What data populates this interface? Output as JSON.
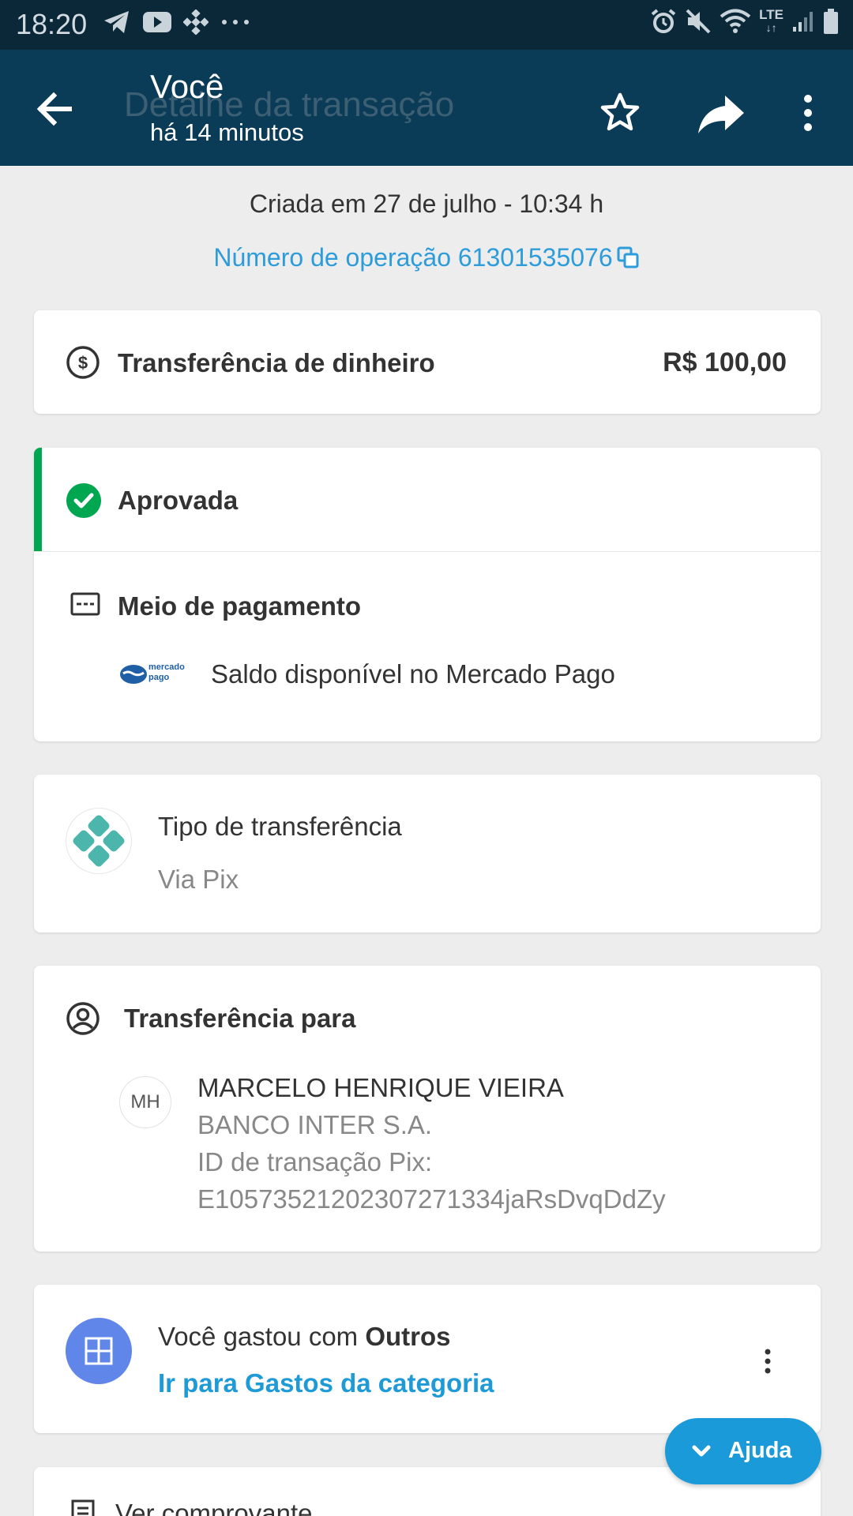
{
  "status_bar": {
    "time": "18:20",
    "network": "LTE"
  },
  "app_bar": {
    "background_title": "Detalhe da transação",
    "title": "Você",
    "subtitle": "há 14 minutos"
  },
  "header_info": {
    "created": "Criada em 27 de julho - 10:34 h",
    "operation_number": "Número de operação 61301535076"
  },
  "amount_card": {
    "label": "Transferência de dinheiro",
    "amount": "R$ 100,00"
  },
  "status_card": {
    "status": "Aprovada",
    "payment_method_label": "Meio de pagamento",
    "payment_method_value": "Saldo disponível no Mercado Pago",
    "logo_text_top": "mercado",
    "logo_text_bottom": "pago"
  },
  "transfer_type_card": {
    "label": "Tipo de transferência",
    "value": "Via Pix"
  },
  "recipient_card": {
    "label": "Transferência para",
    "initials": "MH",
    "name": "MARCELO HENRIQUE VIEIRA",
    "bank": "BANCO INTER S.A.",
    "pix_id_label": "ID de transação Pix:",
    "pix_id": "E10573521202307271334jaRsDvqDdZy"
  },
  "category_card": {
    "text_prefix": "Você gastou com ",
    "category": "Outros",
    "link": "Ir para Gastos da categoria"
  },
  "receipt_card": {
    "label": "Ver comprovante"
  },
  "help_button": {
    "label": "Ajuda"
  },
  "colors": {
    "status_bar": "#0b2839",
    "app_bar": "#0a3b57",
    "approved_green": "#00a650",
    "link_blue": "#2d9cdb",
    "help_button": "#1a9ad9",
    "category_icon": "#5f86e8"
  }
}
